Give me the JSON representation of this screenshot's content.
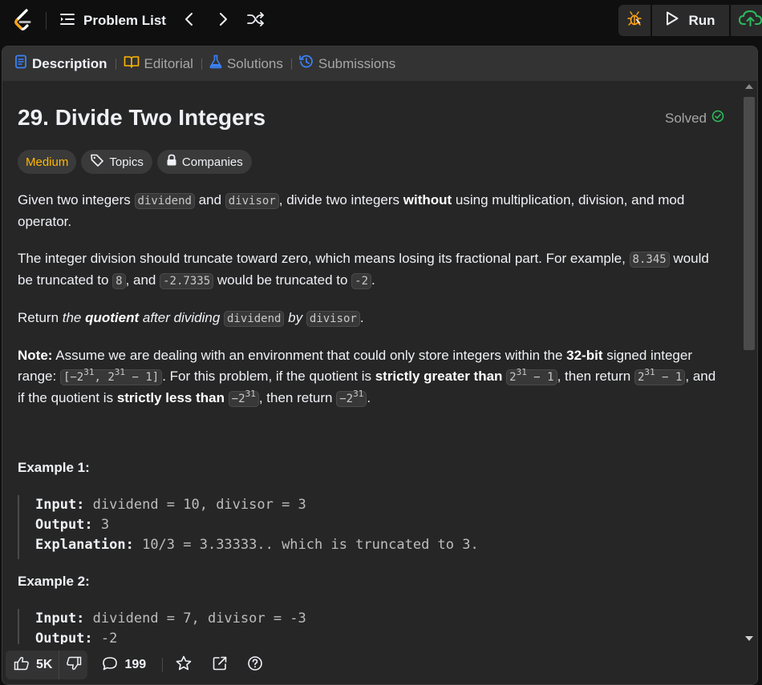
{
  "nav": {
    "problem_list_label": "Problem List",
    "run_label": "Run",
    "brand_color": "#ffa116"
  },
  "tabs": [
    {
      "label": "Description",
      "icon": "description-icon",
      "active": true
    },
    {
      "label": "Editorial",
      "icon": "book-icon",
      "active": false
    },
    {
      "label": "Solutions",
      "icon": "flask-icon",
      "active": false
    },
    {
      "label": "Submissions",
      "icon": "history-icon",
      "active": false
    }
  ],
  "problem": {
    "title": "29. Divide Two Integers",
    "status": "Solved",
    "difficulty": "Medium",
    "topics_label": "Topics",
    "companies_label": "Companies",
    "p1": {
      "t1": "Given two integers ",
      "c1": "dividend",
      "t2": " and ",
      "c2": "divisor",
      "t3": ", divide two integers ",
      "b1": "without",
      "t4": " using multiplication, division, and mod operator."
    },
    "p2": {
      "t1": "The integer division should truncate toward zero, which means losing its fractional part. For example, ",
      "c1": "8.345",
      "t2": " would be truncated to ",
      "c2": "8",
      "t3": ", and ",
      "c3": "-2.7335",
      "t4": " would be truncated to ",
      "c4": "-2",
      "t5": "."
    },
    "p3": {
      "t1": "Return ",
      "i1": "the ",
      "b1": "quotient",
      "i2": " after dividing ",
      "c1": "dividend",
      "i3": " by ",
      "c2": "divisor",
      "t2": "."
    },
    "p4": {
      "b1": "Note:",
      "t1": " Assume we are dealing with an environment that could only store integers within the ",
      "b2": "32-bit",
      "t2": " signed integer range: ",
      "c1a": "[−2",
      "c1s": "31",
      "c1b": ", 2",
      "c1t": "31",
      "c1c": " − 1]",
      "t3": ". For this problem, if the quotient is ",
      "b3": "strictly greater than",
      "t4": " ",
      "c2a": "2",
      "c2s": "31",
      "c2b": " − 1",
      "t5": ", then return ",
      "c3a": "2",
      "c3s": "31",
      "c3b": " − 1",
      "t6": ", and if the quotient is ",
      "b4": "strictly less than",
      "t7": " ",
      "c4a": "−2",
      "c4s": "31",
      "t8": ", then return ",
      "c5a": "−2",
      "c5s": "31",
      "t9": "."
    }
  },
  "examples": [
    {
      "heading": "Example 1:",
      "input_label": "Input:",
      "input": "dividend = 10, divisor = 3",
      "output_label": "Output:",
      "output": "3",
      "explanation_label": "Explanation:",
      "explanation": "10/3 = 3.33333.. which is truncated to 3."
    },
    {
      "heading": "Example 2:",
      "input_label": "Input:",
      "input": "dividend = 7, divisor = -3",
      "output_label": "Output:",
      "output": "-2"
    }
  ],
  "bottom": {
    "likes": "5K",
    "comments": "199"
  }
}
